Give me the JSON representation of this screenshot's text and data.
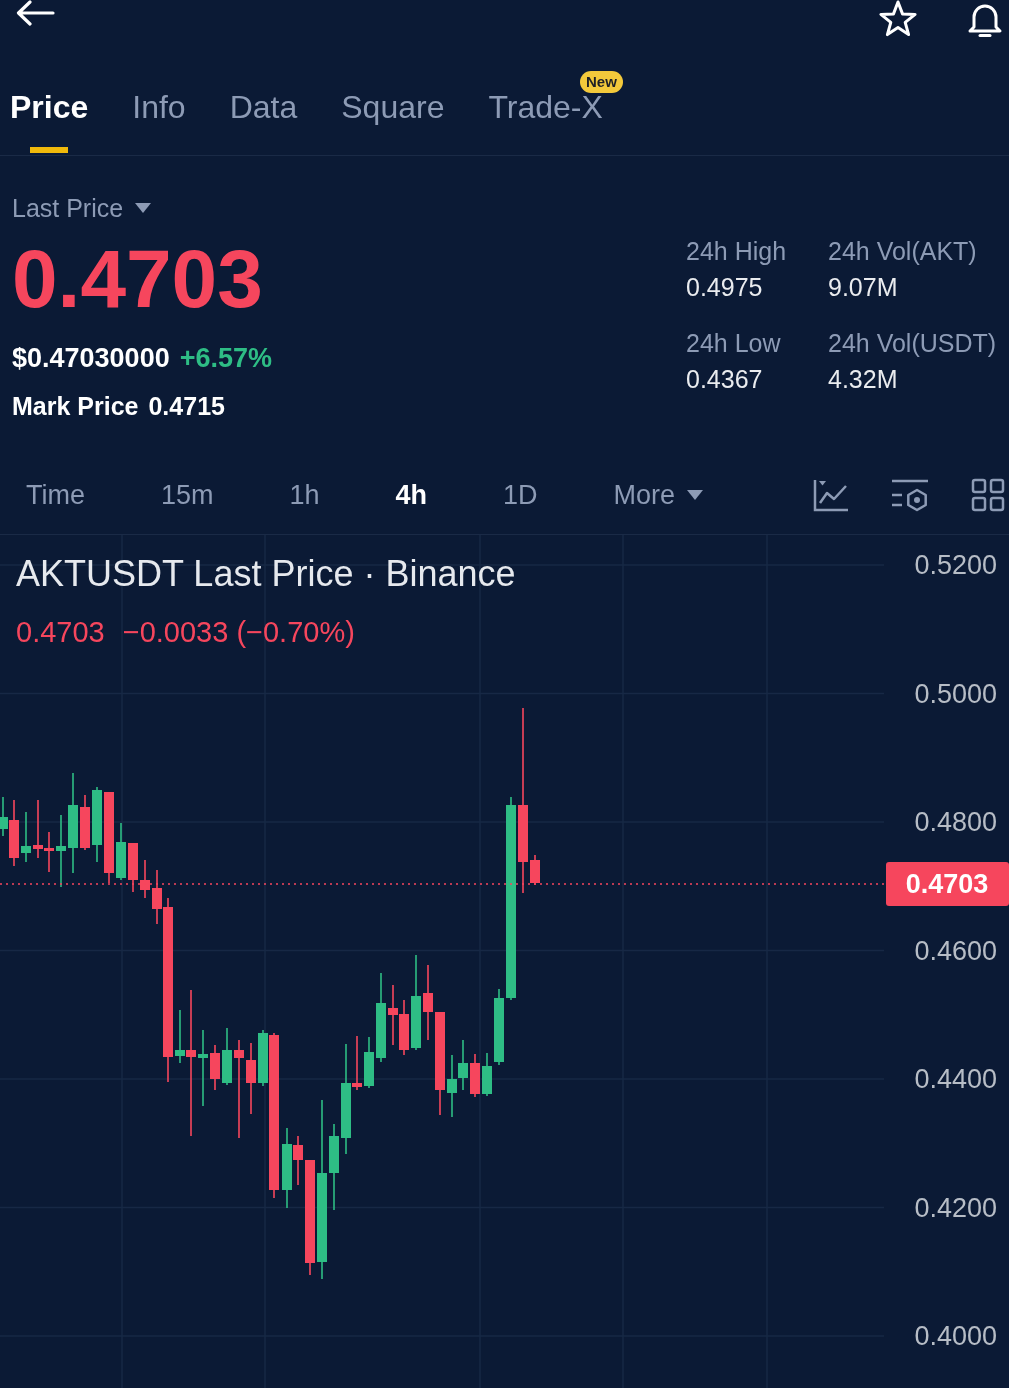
{
  "tabs": [
    {
      "label": "Price",
      "selected": true
    },
    {
      "label": "Info",
      "selected": false
    },
    {
      "label": "Data",
      "selected": false
    },
    {
      "label": "Square",
      "selected": false
    },
    {
      "label": "Trade-X",
      "selected": false,
      "badge": "New"
    }
  ],
  "quote": {
    "price_type": "Last Price",
    "last_price": "0.4703",
    "usd_price": "$0.47030000",
    "change_percent": "+6.57%",
    "mark_price_label": "Mark Price",
    "mark_price": "0.4715"
  },
  "stats": [
    {
      "label": "24h High",
      "value": "0.4975"
    },
    {
      "label": "24h Vol(AKT)",
      "value": "9.07M"
    },
    {
      "label": "24h Low",
      "value": "0.4367"
    },
    {
      "label": "24h Vol(USDT)",
      "value": "4.32M"
    }
  ],
  "intervals": [
    {
      "label": "Time",
      "kind": "interval",
      "selected": false
    },
    {
      "label": "15m",
      "kind": "interval",
      "selected": false
    },
    {
      "label": "1h",
      "kind": "interval",
      "selected": false
    },
    {
      "label": "4h",
      "kind": "interval",
      "selected": true
    },
    {
      "label": "1D",
      "kind": "interval",
      "selected": false
    },
    {
      "label": "More",
      "kind": "dropdown",
      "selected": false
    }
  ],
  "chart": {
    "title": "AKTUSDT Last Price · Binance",
    "last_price": "0.4703",
    "change": "−0.0033 (−0.70%)",
    "price_axis": [
      "0.5200",
      "0.5000",
      "0.4800",
      "0.4600",
      "0.4400",
      "0.4200",
      "0.4000"
    ],
    "price_tag": "0.4703"
  }
}
